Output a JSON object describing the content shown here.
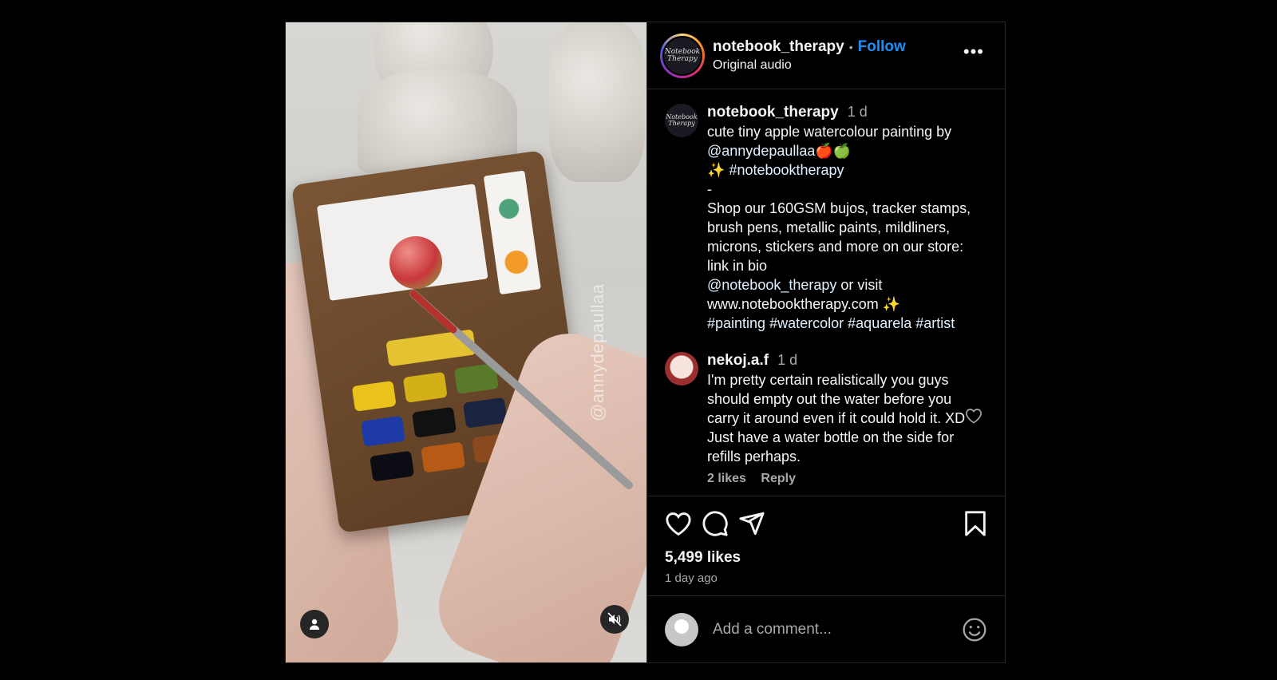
{
  "media": {
    "watermark": "@annydepaullaa",
    "user_tag_icon": "person-icon",
    "mute_icon": "speaker-muted-icon"
  },
  "header": {
    "username": "notebook_therapy",
    "separator": "•",
    "follow_label": "Follow",
    "subtitle": "Original audio",
    "avatar_text": "Notebook Therapy",
    "more_label": "•••"
  },
  "caption": {
    "username": "notebook_therapy",
    "time": "1 d",
    "avatar_text": "Notebook Therapy",
    "line1": "cute tiny apple watercolour painting by",
    "mention1": "@annydepaullaa",
    "emoji1": "🍎🍏",
    "sparkle1": "✨",
    "hashtag_brand": "#notebooktherapy",
    "dash": "-",
    "body": "Shop our 160GSM bujos, tracker stamps, brush pens, metallic paints, mildliners, microns, stickers and more on our store: link in bio",
    "mention2": "@notebook_therapy",
    "or_visit": " or visit",
    "website": "www.notebooktherapy.com ✨",
    "hashtags": [
      "#painting",
      "#watercolor",
      "#aquarela",
      "#artist"
    ]
  },
  "comments": [
    {
      "username": "nekoj.a.f",
      "time": "1 d",
      "text": "I'm pretty certain realistically you guys should empty out the water before you carry it around even if it could hold it. XD Just have a water bottle on the side for refills perhaps.",
      "likes": "2 likes",
      "reply": "Reply"
    }
  ],
  "actions": {
    "likes": "5,499 likes",
    "time_ago": "1 day ago"
  },
  "add_comment": {
    "placeholder": "Add a comment..."
  },
  "colors": {
    "accent": "#1b8ff5",
    "background": "#000000",
    "border": "#262626",
    "muted": "#a8a8a8"
  }
}
